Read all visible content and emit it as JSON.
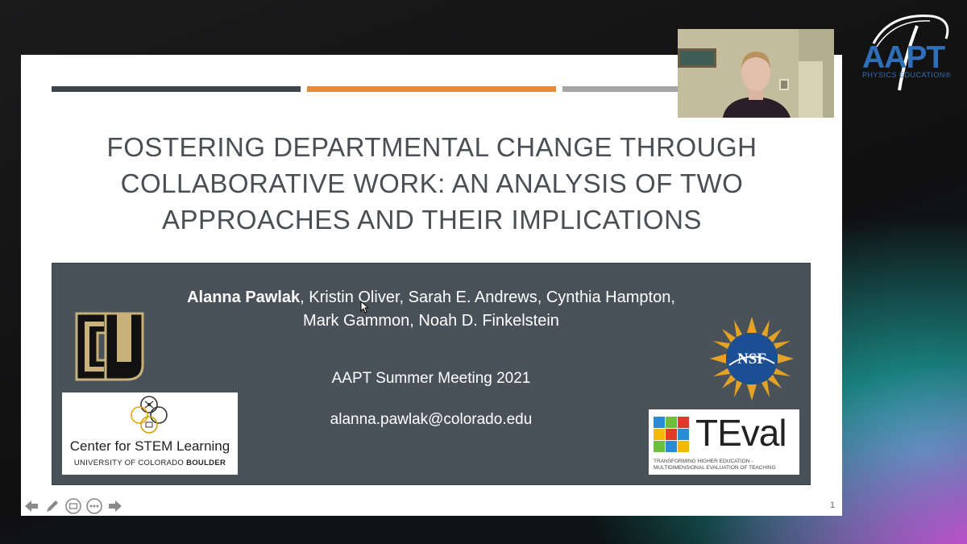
{
  "slide": {
    "title_lines": [
      "FOSTERING DEPARTMENTAL CHANGE THROUGH",
      "COLLABORATIVE WORK: AN ANALYSIS OF TWO",
      "APPROACHES AND THEIR IMPLICATIONS"
    ],
    "lead_author": "Alanna Pawlak",
    "authors_rest_line1": ", Kristin Oliver, Sarah E. Andrews, Cynthia Hampton,",
    "authors_line2": "Mark Gammon, Noah D. Finkelstein",
    "meeting": "AAPT Summer Meeting 2021",
    "email": "alanna.pawlak@colorado.edu",
    "slide_number": "1",
    "colors": {
      "bar1": "#3d464c",
      "bar2": "#e98a32",
      "bar3": "#a6a6a6",
      "panel": "#4a5259"
    }
  },
  "logos": {
    "cu": {
      "text": "CU"
    },
    "stem": {
      "title": "Center for STEM Learning",
      "sub_a": "UNIVERSITY OF COLORADO ",
      "sub_b": "BOULDER"
    },
    "nsf": {
      "text": "NSF"
    },
    "teval": {
      "word": "TEval",
      "sub_line1": "TRANSFORMING HIGHER EDUCATION -",
      "sub_line2": "MULTIDIMENSIONAL EVALUATION OF TEACHING"
    }
  },
  "controls": [
    "arrow-left-icon",
    "pen-icon",
    "slides-icon",
    "more-icon",
    "arrow-right-icon"
  ],
  "watermark": {
    "text": "AAPT",
    "sub": "PHYSICS EDUCATION®"
  }
}
